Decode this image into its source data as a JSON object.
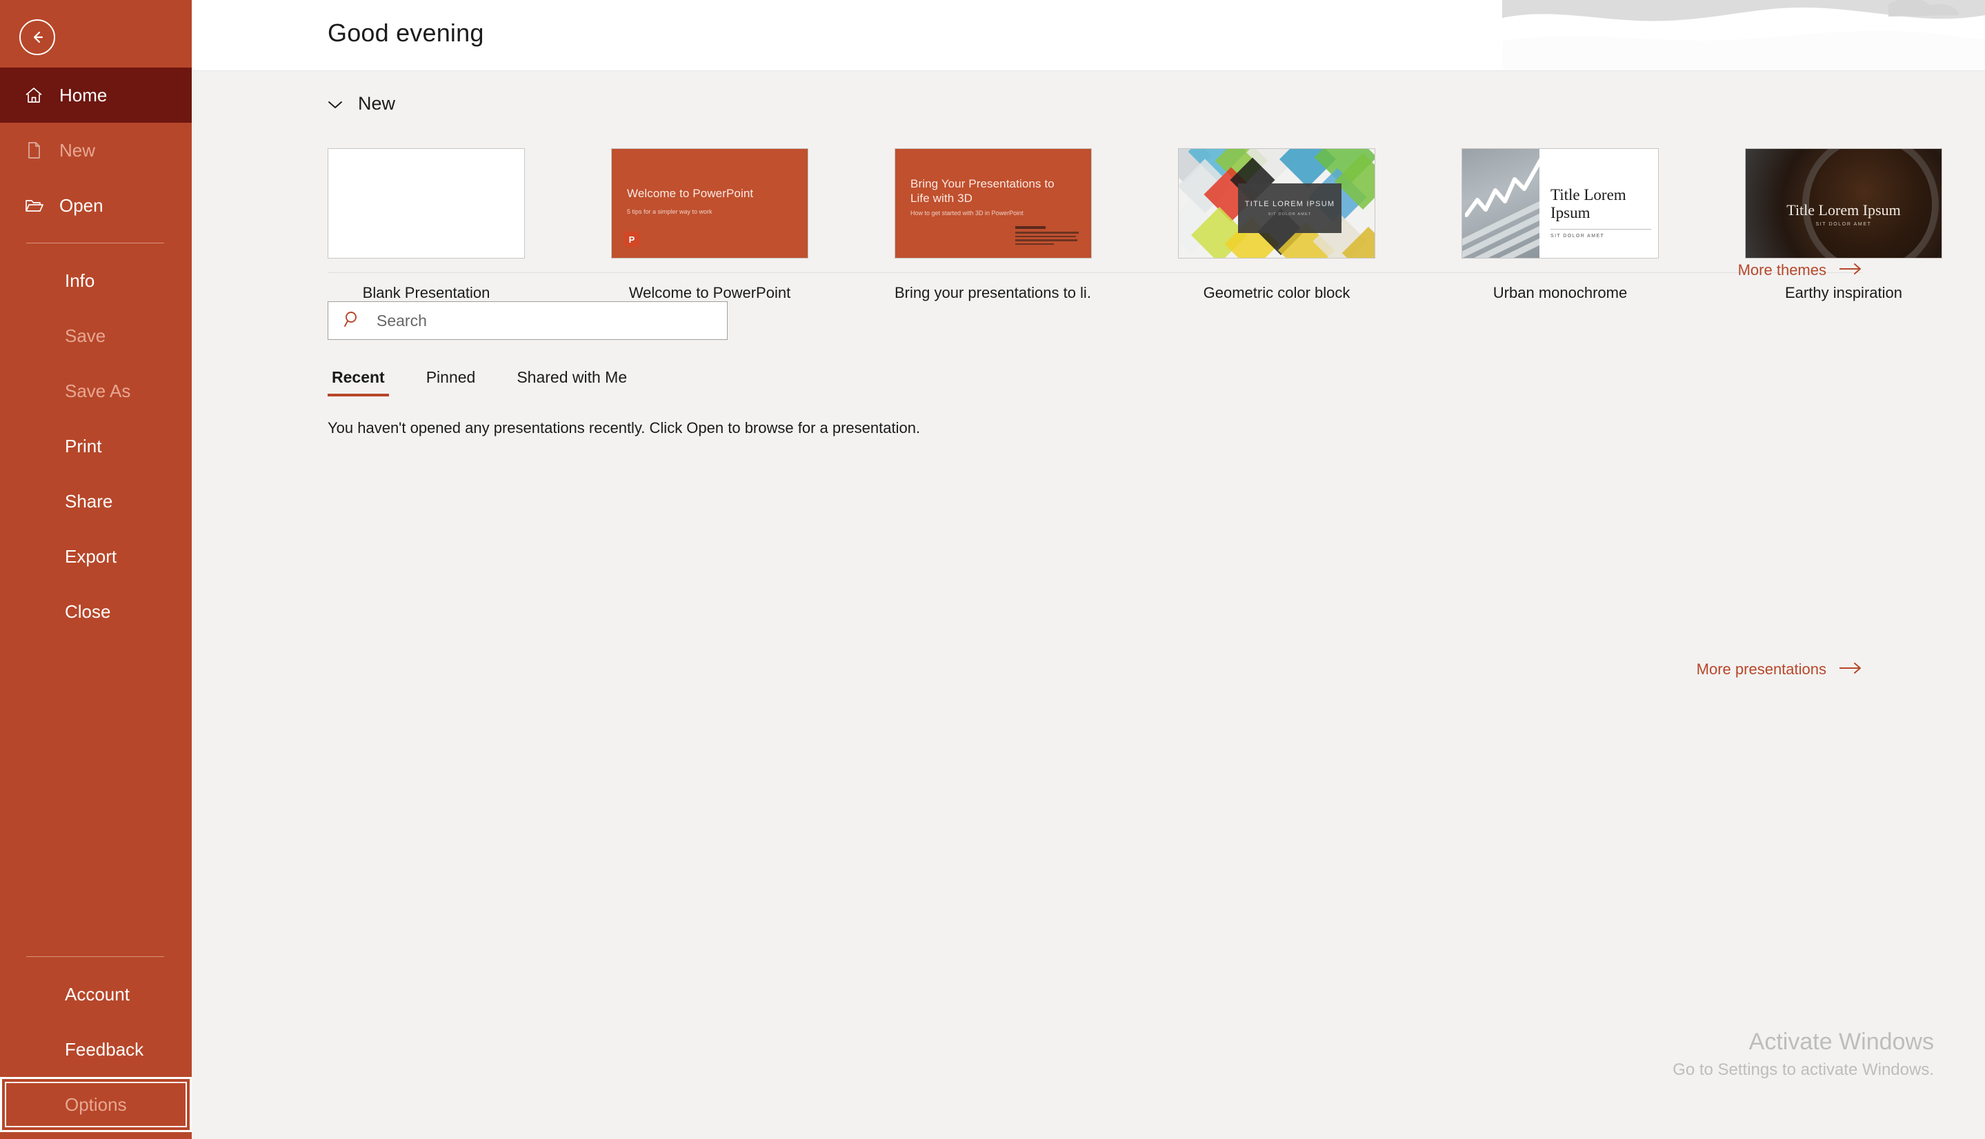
{
  "colors": {
    "sidebar_bg": "#b7472a",
    "sidebar_selected": "#6e1610",
    "accent": "#b7472a",
    "content_bg": "#f3f2f1",
    "header_bg": "#ffffff",
    "watermark": "#bdbdbd"
  },
  "sidebar": {
    "back_button": "back-arrow-icon",
    "top_items": [
      {
        "label": "Home",
        "icon": "home-icon",
        "state": "selected"
      },
      {
        "label": "New",
        "icon": "new-document-icon",
        "state": "disabled"
      },
      {
        "label": "Open",
        "icon": "open-folder-icon",
        "state": "normal"
      }
    ],
    "mid_items": [
      {
        "label": "Info",
        "state": "normal"
      },
      {
        "label": "Save",
        "state": "disabled"
      },
      {
        "label": "Save As",
        "state": "disabled"
      },
      {
        "label": "Print",
        "state": "normal"
      },
      {
        "label": "Share",
        "state": "normal"
      },
      {
        "label": "Export",
        "state": "normal"
      },
      {
        "label": "Close",
        "state": "normal"
      }
    ],
    "bottom_items": [
      {
        "label": "Account",
        "state": "normal"
      },
      {
        "label": "Feedback",
        "state": "normal"
      },
      {
        "label": "Options",
        "state": "focused-disabled"
      }
    ]
  },
  "header": {
    "greeting": "Good evening"
  },
  "new_section": {
    "title": "New",
    "collapse_icon": "chevron-down-icon",
    "templates": [
      {
        "caption": "Blank Presentation",
        "kind": "blank"
      },
      {
        "caption": "Welcome to PowerPoint",
        "kind": "orange",
        "slide_title": "Welcome to PowerPoint",
        "slide_subtitle": "5 tips for a simpler way to work",
        "badge": "P"
      },
      {
        "caption": "Bring your presentations to li...",
        "kind": "orange3d",
        "slide_title": "Bring Your Presentations to Life with 3D",
        "slide_subtitle": "How to get started with 3D in PowerPoint"
      },
      {
        "caption": "Geometric color block",
        "kind": "geometric",
        "slide_title": "TITLE LOREM IPSUM",
        "slide_subtitle": "SIT DOLOR AMET"
      },
      {
        "caption": "Urban monochrome",
        "kind": "urban",
        "slide_title": "Title Lorem Ipsum",
        "slide_subtitle": "SIT DOLOR AMET"
      },
      {
        "caption": "Earthy inspiration",
        "kind": "earthy",
        "slide_title": "Title Lorem Ipsum",
        "slide_subtitle": "SIT DOLOR AMET"
      }
    ],
    "more_themes_label": "More themes",
    "more_themes_icon": "arrow-right-icon"
  },
  "search": {
    "placeholder": "Search",
    "value": "",
    "icon": "search-icon"
  },
  "recent_section": {
    "tabs": [
      {
        "label": "Recent",
        "active": true
      },
      {
        "label": "Pinned",
        "active": false
      },
      {
        "label": "Shared with Me",
        "active": false
      }
    ],
    "empty_message": "You haven't opened any presentations recently. Click Open to browse for a presentation.",
    "more_presentations_label": "More presentations",
    "more_presentations_icon": "arrow-right-icon"
  },
  "watermark": {
    "title": "Activate Windows",
    "subtitle": "Go to Settings to activate Windows."
  }
}
